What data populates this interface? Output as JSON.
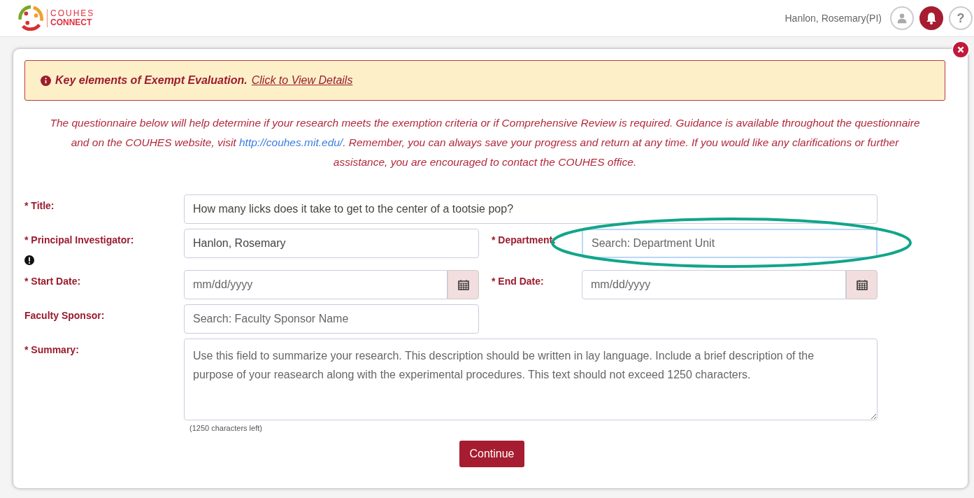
{
  "header": {
    "logo_top": "COUHES",
    "logo_bottom": "CONNECT",
    "user_name": "Hanlon, Rosemary(PI)",
    "help_glyph": "?"
  },
  "alert": {
    "title": "Key elements of Exempt Evaluation.",
    "link": "Click to View Details"
  },
  "intro": {
    "before": "The questionnaire below will help determine if your research meets the exemption criteria or if Comprehensive Review is required. Guidance is available throughout the questionnaire and on the COUHES website, visit",
    "link": "http://couhes.mit.edu/",
    "after": ". Remember, you can always save your progress and return at any time. If you would like any clarifications or further assistance, you are encouraged to contact the COUHES office."
  },
  "form": {
    "title": {
      "label": "* Title:",
      "value": "How many licks does it take to get to the center of a tootsie pop?"
    },
    "pi": {
      "label": "* Principal Investigator:",
      "value": "Hanlon, Rosemary"
    },
    "department": {
      "label": "* Department:",
      "placeholder": "Search: Department Unit",
      "highlighted": true
    },
    "start_date": {
      "label": "* Start Date:",
      "placeholder": "mm/dd/yyyy"
    },
    "end_date": {
      "label": "* End Date:",
      "placeholder": "mm/dd/yyyy"
    },
    "faculty_sponsor": {
      "label": "Faculty Sponsor:",
      "placeholder": "Search: Faculty Sponsor Name"
    },
    "summary": {
      "label": "* Summary:",
      "placeholder": "Use this field to summarize your research. This description should be written in lay language. Include a brief description of the purpose of your reasearch along with the experimental procedures. This text should not exceed 1250 characters.",
      "counter": "(1250 characters left)"
    }
  },
  "buttons": {
    "continue": "Continue"
  }
}
